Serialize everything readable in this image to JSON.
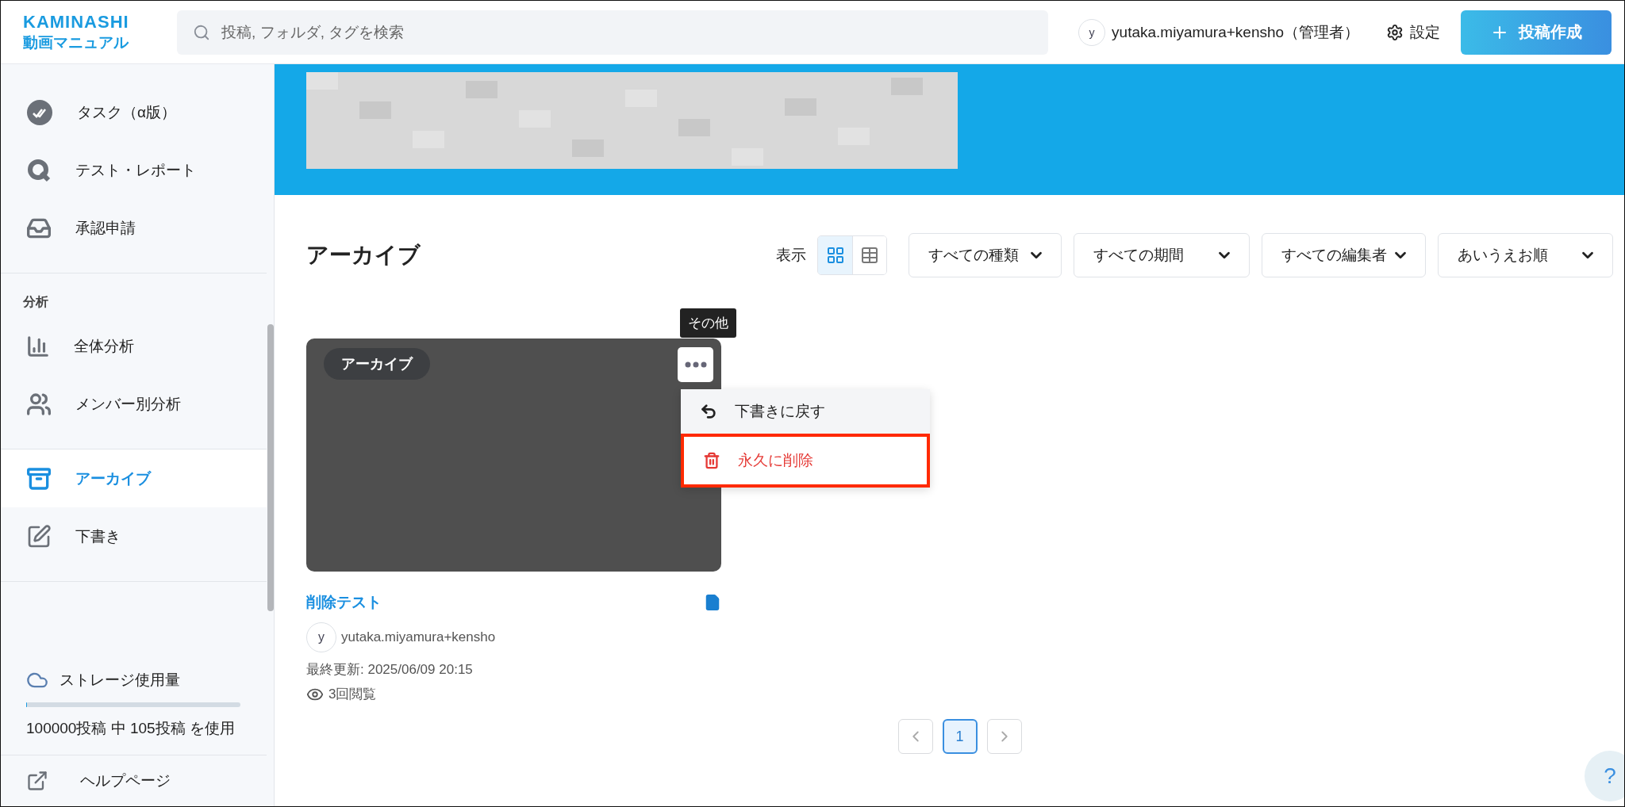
{
  "header": {
    "logo": {
      "brand": "KAMINASHI",
      "product": "動画マニュアル"
    },
    "search": {
      "placeholder": "投稿, フォルダ, タグを検索"
    },
    "user": {
      "avatar": "y",
      "name": "yutaka.miyamura+kensho（管理者）"
    },
    "settings": "設定",
    "create_button": "投稿作成"
  },
  "sidebar": {
    "sections": [
      {
        "items": [
          {
            "kind": "task",
            "label": "タスク（α版）",
            "selected": false
          },
          {
            "kind": "test",
            "label": "テスト・レポート",
            "selected": false
          },
          {
            "kind": "approval",
            "label": "承認申請",
            "selected": false
          }
        ]
      },
      {
        "heading": "分析",
        "items": [
          {
            "kind": "overall",
            "label": "全体分析",
            "selected": false
          },
          {
            "kind": "members",
            "label": "メンバー別分析",
            "selected": false
          }
        ]
      },
      {
        "items": [
          {
            "kind": "archive",
            "label": "アーカイブ",
            "selected": true
          },
          {
            "kind": "draft",
            "label": "下書き",
            "selected": false
          }
        ]
      }
    ],
    "storage": {
      "label": "ストレージ使用量",
      "level": 0.00105,
      "usage": "100000投稿 中 105投稿 を使用"
    },
    "help": "ヘルプページ"
  },
  "content": {
    "title": "アーカイブ",
    "view_label": "表示",
    "view_modes": [
      {
        "kind": "grid",
        "selected": true
      },
      {
        "kind": "list",
        "selected": false
      }
    ],
    "filters": [
      "すべての種類",
      "すべての期間",
      "すべての編集者",
      "あいうえお順"
    ],
    "cards": [
      {
        "badge": "アーカイブ",
        "tooltip": "その他",
        "title": "削除テスト",
        "author_avatar": "y",
        "author": "yutaka.miyamura+kensho",
        "updated": "最終更新: 2025/06/09 20:15",
        "views": "3回閲覧",
        "menu": [
          {
            "kind": "restore",
            "label": "下書きに戻す",
            "highlighted": false
          },
          {
            "kind": "delete",
            "label": "永久に削除",
            "highlighted": true
          }
        ]
      }
    ],
    "pages": [
      {
        "label": "1",
        "selected": true
      }
    ]
  },
  "help_button": "?"
}
